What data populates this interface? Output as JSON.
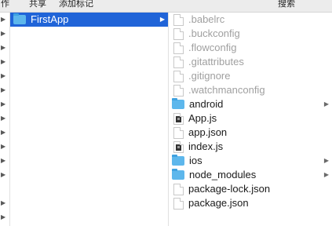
{
  "toolbar": {
    "item1": "作",
    "item2": "共享",
    "item3": "添加标记",
    "item4": "搜索"
  },
  "middle_column": {
    "items": [
      {
        "label": "FirstApp",
        "icon": "folder-icon",
        "selected": true
      }
    ]
  },
  "right_column": {
    "items": [
      {
        "label": ".babelrc",
        "icon": "document-icon",
        "dim": true
      },
      {
        "label": ".buckconfig",
        "icon": "document-icon",
        "dim": true
      },
      {
        "label": ".flowconfig",
        "icon": "document-icon",
        "dim": true
      },
      {
        "label": ".gitattributes",
        "icon": "document-icon",
        "dim": true
      },
      {
        "label": ".gitignore",
        "icon": "document-icon",
        "dim": true
      },
      {
        "label": ".watchmanconfig",
        "icon": "document-icon",
        "dim": true
      },
      {
        "label": "android",
        "icon": "folder-icon",
        "dim": false
      },
      {
        "label": "App.js",
        "icon": "js-file-icon",
        "dim": false
      },
      {
        "label": "app.json",
        "icon": "document-icon",
        "dim": false
      },
      {
        "label": "index.js",
        "icon": "js-file-icon",
        "dim": false
      },
      {
        "label": "ios",
        "icon": "folder-icon",
        "dim": false
      },
      {
        "label": "node_modules",
        "icon": "folder-icon",
        "dim": false
      },
      {
        "label": "package-lock.json",
        "icon": "document-icon",
        "dim": false
      },
      {
        "label": "package.json",
        "icon": "document-icon",
        "dim": false
      }
    ]
  },
  "colors": {
    "selection": "#2064d8",
    "folder": "#5db7ec",
    "hidden_text": "#a0a0a0"
  }
}
